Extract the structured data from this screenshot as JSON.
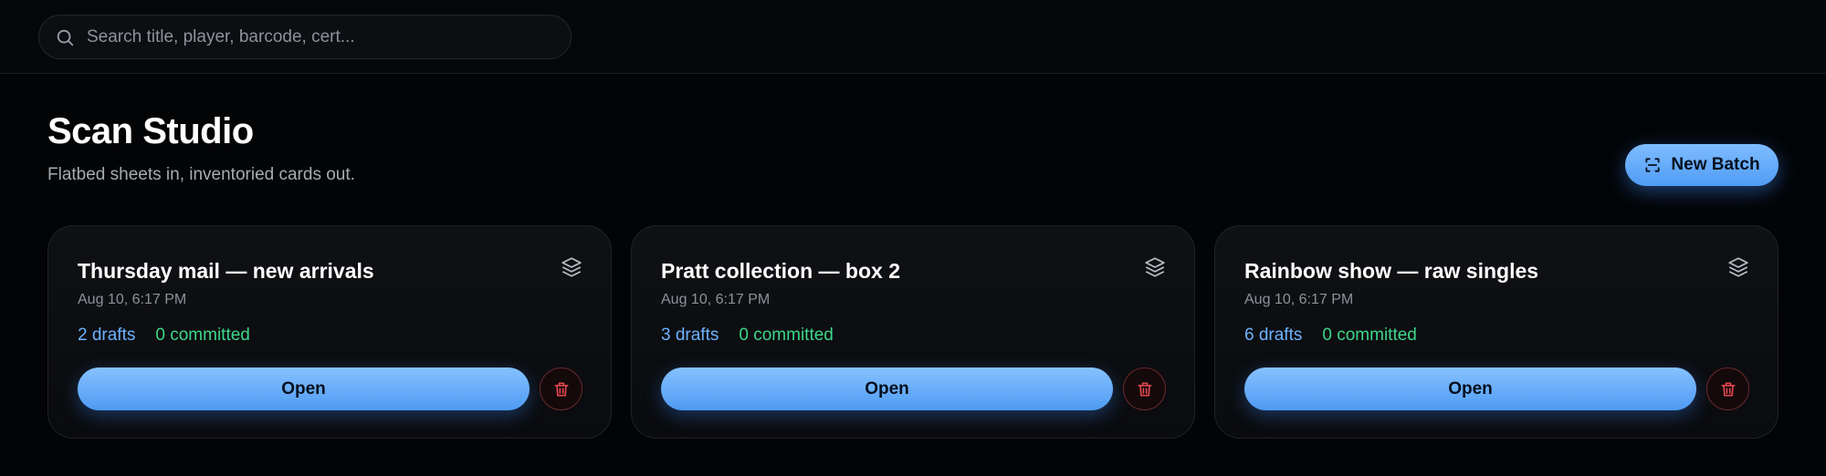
{
  "search": {
    "placeholder": "Search title, player, barcode, cert...",
    "value": ""
  },
  "header": {
    "title": "Scan Studio",
    "subtitle": "Flatbed sheets in, inventoried cards out.",
    "new_batch_label": "New Batch"
  },
  "colors": {
    "accent": "#5aa8ff",
    "drafts": "#6fb2ff",
    "committed": "#3fd68a",
    "danger": "#e0474f",
    "background": "#030406"
  },
  "batches": [
    {
      "title": "Thursday mail — new arrivals",
      "date": "Aug 10, 6:17 PM",
      "drafts": "2 drafts",
      "committed": "0 committed",
      "open_label": "Open",
      "icon": "layers-icon"
    },
    {
      "title": "Pratt collection — box 2",
      "date": "Aug 10, 6:17 PM",
      "drafts": "3 drafts",
      "committed": "0 committed",
      "open_label": "Open",
      "icon": "layers-icon"
    },
    {
      "title": "Rainbow show — raw singles",
      "date": "Aug 10, 6:17 PM",
      "drafts": "6 drafts",
      "committed": "0 committed",
      "open_label": "Open",
      "icon": "layers-icon"
    }
  ]
}
